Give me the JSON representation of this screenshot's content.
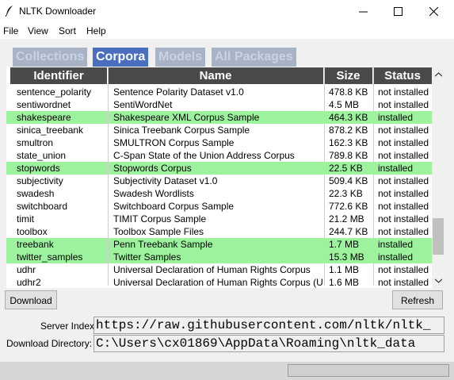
{
  "window": {
    "title": "NLTK Downloader",
    "minimize_icon": "minimize-icon",
    "maximize_icon": "maximize-icon",
    "close_icon": "close-icon"
  },
  "menu": [
    "File",
    "View",
    "Sort",
    "Help"
  ],
  "tabs": [
    {
      "label": "Collections",
      "active": false
    },
    {
      "label": "Corpora",
      "active": true
    },
    {
      "label": "Models",
      "active": false
    },
    {
      "label": "All Packages",
      "active": false
    }
  ],
  "table": {
    "columns": [
      "Identifier",
      "Name",
      "Size",
      "Status"
    ],
    "rows": [
      {
        "id": "sentence_polarity",
        "name": "Sentence Polarity Dataset v1.0",
        "size": "478.8 KB",
        "status": "not installed",
        "installed": false
      },
      {
        "id": "sentiwordnet",
        "name": "SentiWordNet",
        "size": "4.5 MB",
        "status": "not installed",
        "installed": false
      },
      {
        "id": "shakespeare",
        "name": "Shakespeare XML Corpus Sample",
        "size": "464.3 KB",
        "status": "installed",
        "installed": true
      },
      {
        "id": "sinica_treebank",
        "name": "Sinica Treebank Corpus Sample",
        "size": "878.2 KB",
        "status": "not installed",
        "installed": false
      },
      {
        "id": "smultron",
        "name": "SMULTRON Corpus Sample",
        "size": "162.3 KB",
        "status": "not installed",
        "installed": false
      },
      {
        "id": "state_union",
        "name": "C-Span State of the Union Address Corpus",
        "size": "789.8 KB",
        "status": "not installed",
        "installed": false
      },
      {
        "id": "stopwords",
        "name": "Stopwords Corpus",
        "size": "22.5 KB",
        "status": "installed",
        "installed": true
      },
      {
        "id": "subjectivity",
        "name": "Subjectivity Dataset v1.0",
        "size": "509.4 KB",
        "status": "not installed",
        "installed": false
      },
      {
        "id": "swadesh",
        "name": "Swadesh Wordlists",
        "size": "22.3 KB",
        "status": "not installed",
        "installed": false
      },
      {
        "id": "switchboard",
        "name": "Switchboard Corpus Sample",
        "size": "772.6 KB",
        "status": "not installed",
        "installed": false
      },
      {
        "id": "timit",
        "name": "TIMIT Corpus Sample",
        "size": "21.2 MB",
        "status": "not installed",
        "installed": false
      },
      {
        "id": "toolbox",
        "name": "Toolbox Sample Files",
        "size": "244.7 KB",
        "status": "not installed",
        "installed": false
      },
      {
        "id": "treebank",
        "name": "Penn Treebank Sample",
        "size": "1.7 MB",
        "status": "installed",
        "installed": true
      },
      {
        "id": "twitter_samples",
        "name": "Twitter Samples",
        "size": "15.3 MB",
        "status": "installed",
        "installed": true
      },
      {
        "id": "udhr",
        "name": "Universal Declaration of Human Rights Corpus",
        "size": "1.1 MB",
        "status": "not installed",
        "installed": false
      },
      {
        "id": "udhr2",
        "name": "Universal Declaration of Human Rights Corpus (Ur",
        "size": "1.6 MB",
        "status": "not installed",
        "installed": false
      }
    ]
  },
  "buttons": {
    "download": "Download",
    "refresh": "Refresh"
  },
  "server_index": {
    "label": "Server Index:",
    "value": "https://raw.githubusercontent.com/nltk/nltk_"
  },
  "download_directory": {
    "label": "Download Directory:",
    "value": "C:\\Users\\cx01869\\AppData\\Roaming\\nltk_data"
  },
  "colors": {
    "installed_row": "#9df39d",
    "active_tab": "#4a6fbe",
    "inactive_tab": "#a8b4c6",
    "header_bg": "#4a4a4a"
  }
}
